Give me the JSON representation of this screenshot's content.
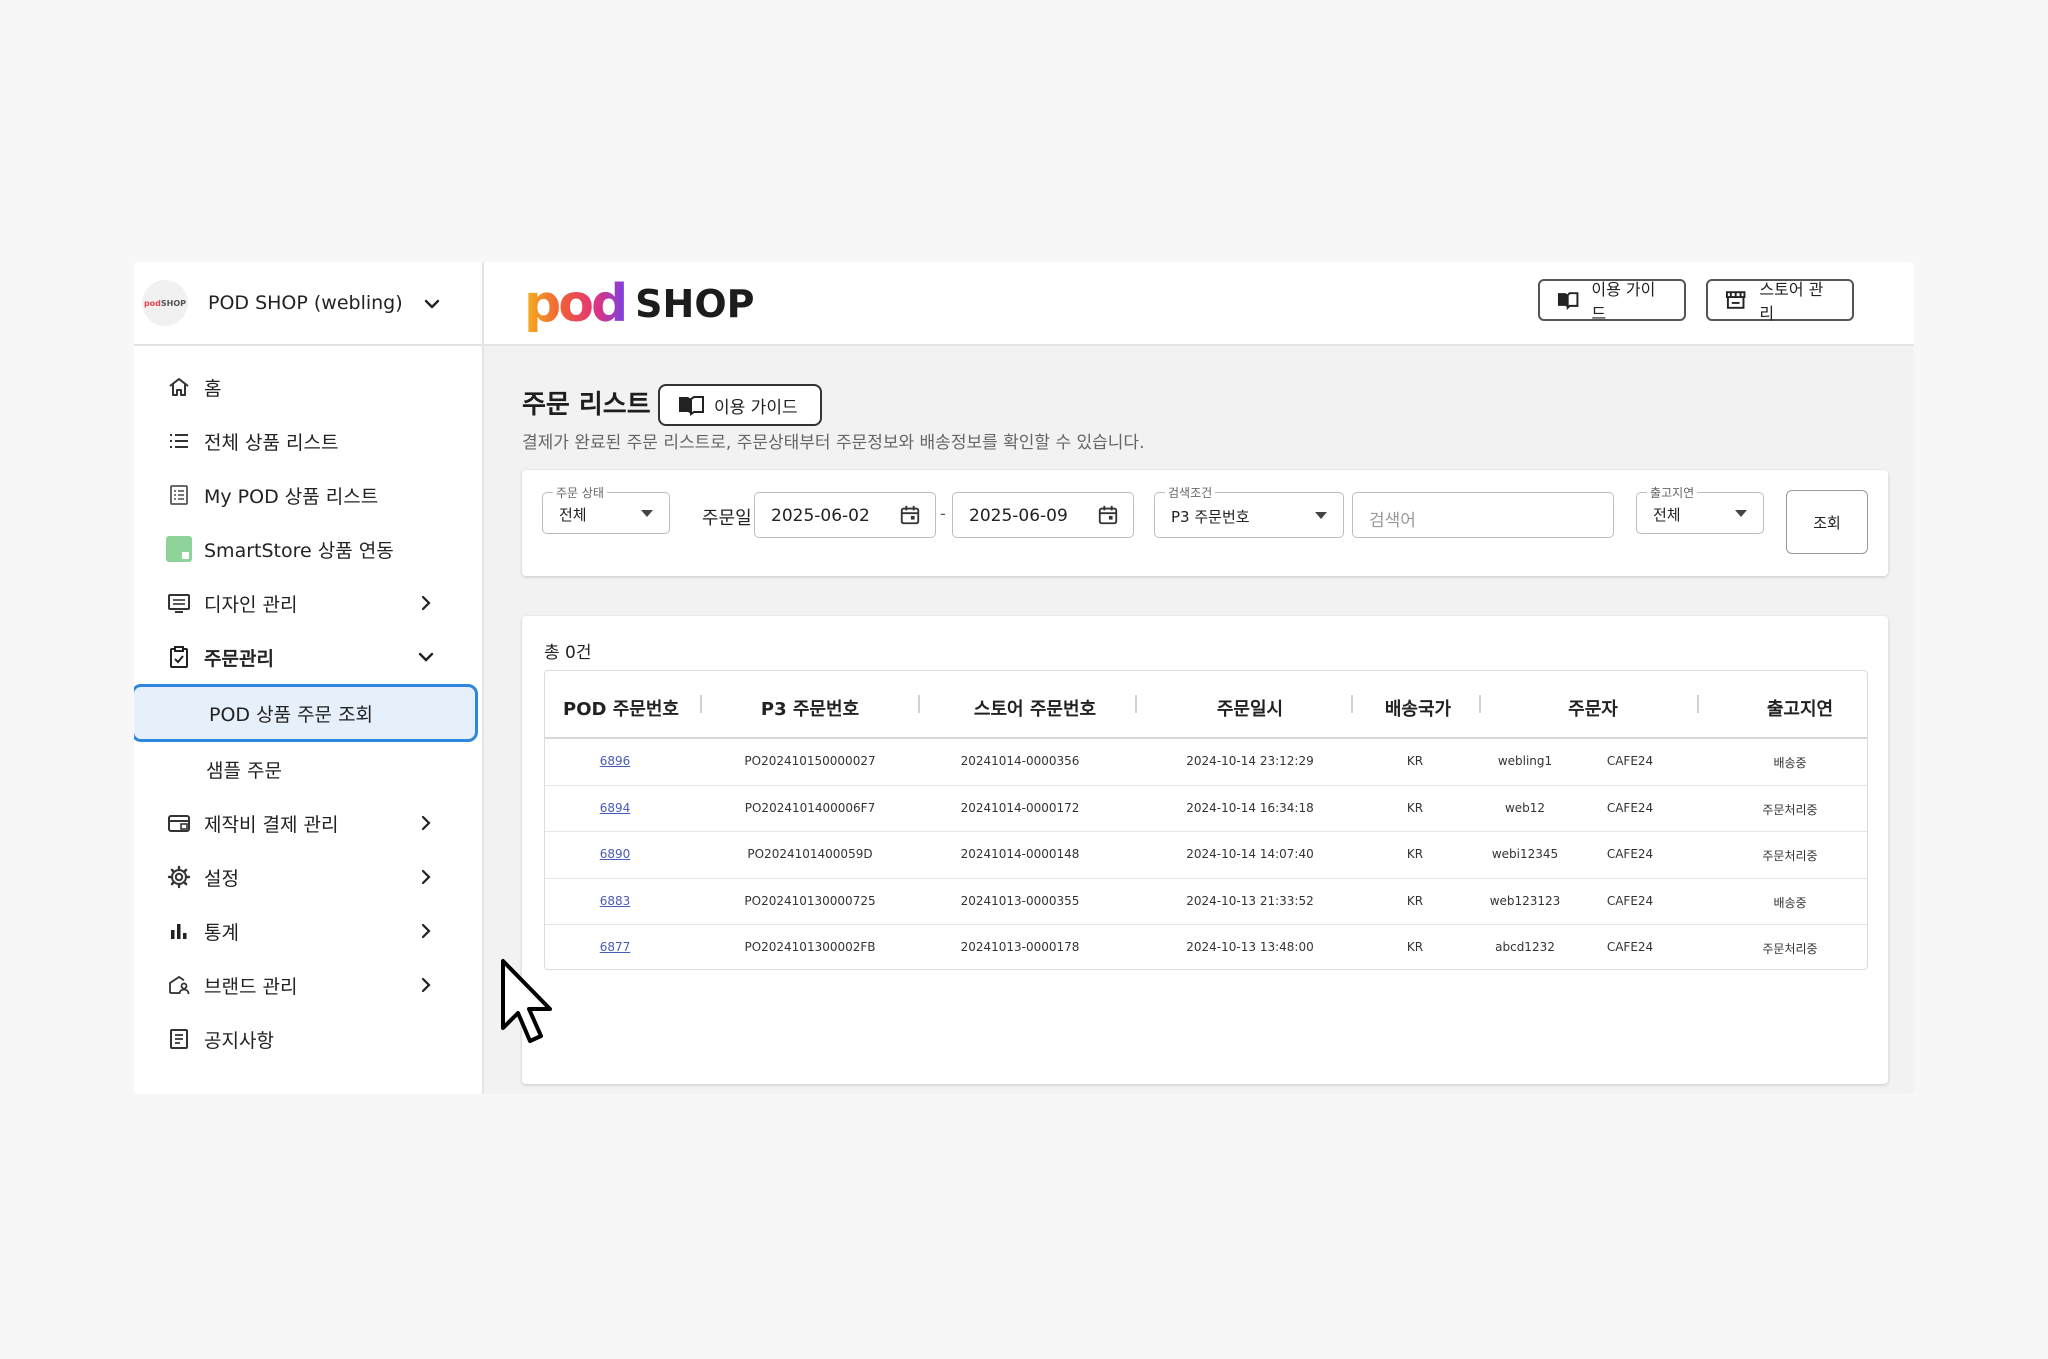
{
  "sidebar": {
    "store_name": "POD SHOP (webling)",
    "logo_text": "pod SHOP",
    "items": [
      {
        "label": "홈",
        "icon": "home-icon"
      },
      {
        "label": "전체 상품 리스트",
        "icon": "list-icon"
      },
      {
        "label": "My POD 상품 리스트",
        "icon": "document-list-icon"
      },
      {
        "label": "SmartStore 상품 연동",
        "icon": "smartstore-icon"
      },
      {
        "label": "디자인 관리",
        "icon": "monitor-icon"
      },
      {
        "label": "주문관리",
        "icon": "clipboard-check-icon"
      },
      {
        "label": "POD 상품 주문 조회"
      },
      {
        "label": "샘플 주문"
      },
      {
        "label": "제작비 결제 관리",
        "icon": "credit-card-icon"
      },
      {
        "label": "설정",
        "icon": "gear-icon"
      },
      {
        "label": "통계",
        "icon": "bar-chart-icon"
      },
      {
        "label": "브랜드 관리",
        "icon": "brand-icon"
      },
      {
        "label": "공지사항",
        "icon": "notice-icon"
      }
    ]
  },
  "header": {
    "logo_pod": "pod",
    "logo_shop": "SHOP",
    "guide_label": "이용 가이드",
    "store_label": "스토어 관리"
  },
  "page": {
    "title": "주문 리스트",
    "guide_label": "이용 가이드",
    "description": "결제가 완료된 주문 리스트로, 주문상태부터 주문정보와 배송정보를 확인할 수 있습니다."
  },
  "filters": {
    "status_label": "주문 상태",
    "status_value": "전체",
    "date_label": "주문일",
    "date_from": "2025-06-02",
    "date_sep": "-",
    "date_to": "2025-06-09",
    "condition_label": "검색조건",
    "condition_value": "P3 주문번호",
    "search_placeholder": "검색어",
    "delay_label": "출고지연",
    "delay_value": "전체",
    "search_button": "조회"
  },
  "table": {
    "total": "총 0건",
    "columns": [
      "POD 주문번호",
      "P3 주문번호",
      "스토어 주문번호",
      "주문일시",
      "배송국가",
      "주문자",
      "출고지연"
    ],
    "rows": [
      {
        "pod": "6896",
        "p3": "PO202410150000027",
        "store": "20241014-0000356",
        "date": "2024-10-14 23:12:29",
        "country": "KR",
        "orderer": "webling1",
        "channel": "CAFE24",
        "delay": "배송중"
      },
      {
        "pod": "6894",
        "p3": "PO2024101400006F7",
        "store": "20241014-0000172",
        "date": "2024-10-14 16:34:18",
        "country": "KR",
        "orderer": "web12",
        "channel": "CAFE24",
        "delay": "주문처리중"
      },
      {
        "pod": "6890",
        "p3": "PO2024101400059D",
        "store": "20241014-0000148",
        "date": "2024-10-14 14:07:40",
        "country": "KR",
        "orderer": "webi12345",
        "channel": "CAFE24",
        "delay": "주문처리중"
      },
      {
        "pod": "6883",
        "p3": "PO202410130000725",
        "store": "20241013-0000355",
        "date": "2024-10-13 21:33:52",
        "country": "KR",
        "orderer": "web123123",
        "channel": "CAFE24",
        "delay": "배송중"
      },
      {
        "pod": "6877",
        "p3": "PO2024101300002FB",
        "store": "20241013-0000178",
        "date": "2024-10-13 13:48:00",
        "country": "KR",
        "orderer": "abcd1232",
        "channel": "CAFE24",
        "delay": "주문처리중"
      }
    ]
  },
  "colors": {
    "accent": "#2e86de",
    "active_bg": "#e6f0fb",
    "link": "#4a5ab8"
  }
}
